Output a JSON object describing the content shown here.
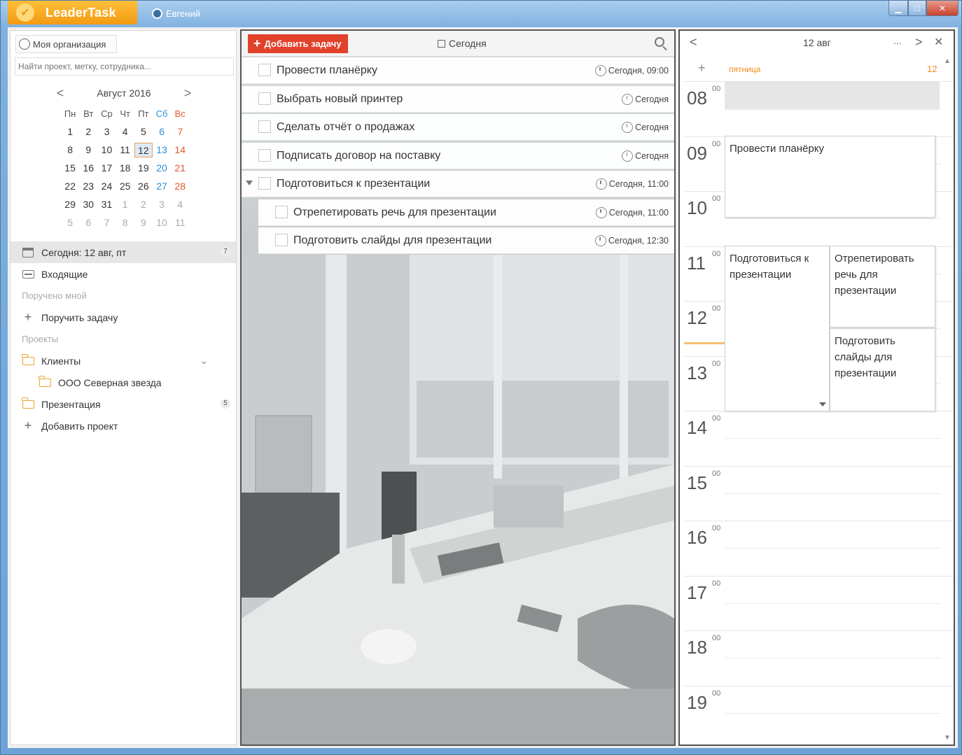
{
  "app": {
    "name": "LeaderTask",
    "user": "Евгений",
    "window_controls": {
      "minimize": "▁",
      "maximize": "□",
      "close": "✕"
    }
  },
  "left": {
    "org_button": "Моя организация",
    "search_placeholder": "Найти проект, метку, сотрудника...",
    "calendar": {
      "month_label": "Август 2016",
      "prev": "<",
      "next": ">",
      "weekdays": [
        "Пн",
        "Вт",
        "Ср",
        "Чт",
        "Пт",
        "Сб",
        "Вс"
      ],
      "weeks": [
        [
          "1",
          "2",
          "3",
          "4",
          "5",
          "6",
          "7"
        ],
        [
          "8",
          "9",
          "10",
          "11",
          "12",
          "13",
          "14"
        ],
        [
          "15",
          "16",
          "17",
          "18",
          "19",
          "20",
          "21"
        ],
        [
          "22",
          "23",
          "24",
          "25",
          "26",
          "27",
          "28"
        ],
        [
          "29",
          "30",
          "31",
          "1",
          "2",
          "3",
          "4"
        ],
        [
          "5",
          "6",
          "7",
          "8",
          "9",
          "10",
          "11"
        ]
      ],
      "selected": "12"
    },
    "nav": {
      "today": {
        "label": "Сегодня: 12 авг, пт",
        "count": "7"
      },
      "inbox": "Входящие",
      "assigned_by_me": "Поручено мной",
      "assign_task": "Поручить задачу",
      "projects_header": "Проекты",
      "clients": "Клиенты",
      "client_child": "ООО Северная звезда",
      "presentation": {
        "label": "Презентация",
        "count": "5"
      },
      "add_project": "Добавить проект"
    }
  },
  "middle": {
    "add_task_button": "Добавить задачу",
    "filter_label": "Сегодня",
    "tasks": [
      {
        "title": "Провести планёрку",
        "due": "Сегодня, 09:00"
      },
      {
        "title": "Выбрать новый принтер",
        "due": "Сегодня"
      },
      {
        "title": "Сделать отчёт о продажах",
        "due": "Сегодня"
      },
      {
        "title": "Подписать договор на поставку",
        "due": "Сегодня"
      },
      {
        "title": "Подготовиться к презентации",
        "due": "Сегодня, 11:00"
      },
      {
        "title": "Отрепетировать речь для презентации",
        "due": "Сегодня, 11:00"
      },
      {
        "title": "Подготовить слайды для презентации",
        "due": "Сегодня, 12:30"
      }
    ]
  },
  "right": {
    "date_title": "12 авг",
    "more": "...",
    "weekday": "пятница",
    "day_number": "12",
    "hours": [
      "08",
      "09",
      "10",
      "11",
      "12",
      "13",
      "14",
      "15",
      "16",
      "17",
      "18",
      "19"
    ],
    "minutes_sup": "00",
    "events": [
      {
        "title": "Провести планёрку"
      },
      {
        "title": "Подготовиться к презентации"
      },
      {
        "title": "Отрепетировать речь для презентации"
      },
      {
        "title": "Подготовить слайды для презентации"
      }
    ]
  }
}
